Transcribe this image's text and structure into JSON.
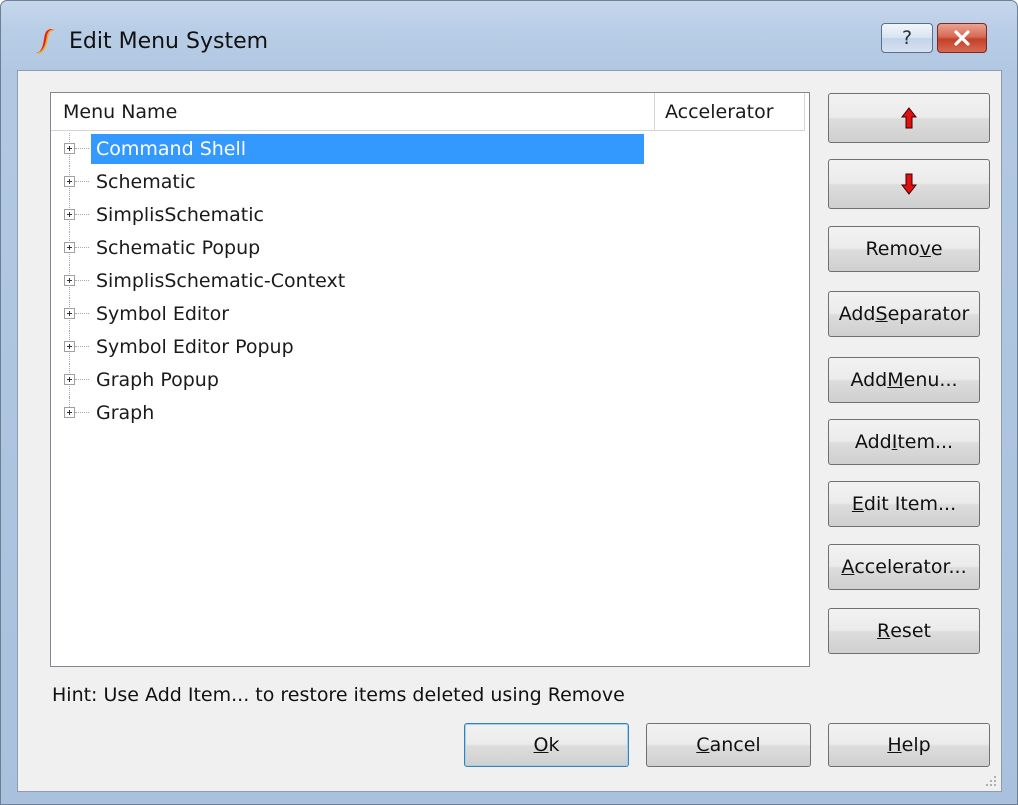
{
  "window": {
    "title": "Edit Menu System"
  },
  "titlebar": {
    "help_label": "?"
  },
  "tree": {
    "columns": {
      "name": "Menu Name",
      "accelerator": "Accelerator"
    },
    "items": [
      {
        "label": "Command Shell"
      },
      {
        "label": "Schematic"
      },
      {
        "label": "SimplisSchematic"
      },
      {
        "label": "Schematic Popup"
      },
      {
        "label": "SimplisSchematic-Context"
      },
      {
        "label": "Symbol Editor"
      },
      {
        "label": "Symbol Editor Popup"
      },
      {
        "label": "Graph Popup"
      },
      {
        "label": "Graph"
      }
    ],
    "selected_index": 0
  },
  "buttons": {
    "remove": {
      "before": "Remo",
      "mnemonic": "v",
      "after": "e"
    },
    "add_separator": {
      "before": "Add ",
      "mnemonic": "S",
      "after": "eparator"
    },
    "add_menu": {
      "before": "Add ",
      "mnemonic": "M",
      "after": "enu..."
    },
    "add_item": {
      "before": "Add ",
      "mnemonic": "I",
      "after": "tem..."
    },
    "edit_item": {
      "before": "",
      "mnemonic": "E",
      "after": "dit Item..."
    },
    "accelerator": {
      "before": "",
      "mnemonic": "A",
      "after": "ccelerator..."
    },
    "reset": {
      "before": "",
      "mnemonic": "R",
      "after": "eset"
    },
    "ok": {
      "before": "",
      "mnemonic": "O",
      "after": "k"
    },
    "cancel": {
      "before": "",
      "mnemonic": "C",
      "after": "ancel"
    },
    "help": {
      "before": "",
      "mnemonic": "H",
      "after": "elp"
    }
  },
  "hint": "Hint: Use Add Item... to restore items deleted using Remove",
  "colors": {
    "selection": "#3399ff",
    "arrow": "#e01010",
    "close": "#c4402a"
  },
  "icons": {
    "app": "simplis-logo-icon",
    "up": "arrow-up-icon",
    "down": "arrow-down-icon",
    "close": "close-icon",
    "grip": "resize-grip-icon"
  }
}
